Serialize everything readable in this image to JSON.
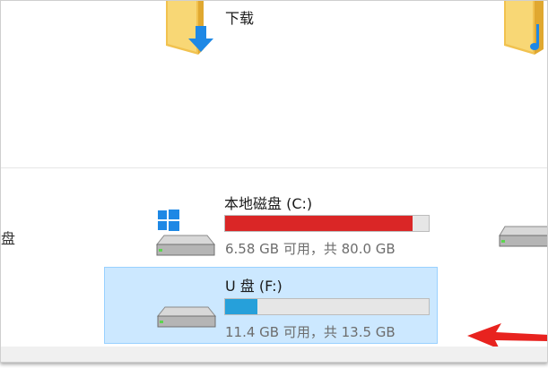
{
  "folders": [
    {
      "label": "下载",
      "icon": "downloads-folder-icon"
    },
    {
      "label": "",
      "icon": "music-folder-icon"
    }
  ],
  "left_partial_label": "盘",
  "drives": [
    {
      "name": "本地磁盘 (C:)",
      "info": "6.58 GB 可用，共 80.0 GB",
      "usage_fraction": 0.92,
      "bar_color": "#da2626",
      "icon": "windows-drive-icon"
    },
    {
      "name": "U 盘 (F:)",
      "info": "11.4 GB 可用，共 13.5 GB",
      "usage_fraction": 0.16,
      "bar_color": "#26a0da",
      "icon": "usb-drive-icon",
      "selected": true
    }
  ],
  "colors": {
    "selection_bg": "#cce8ff",
    "selection_border": "#99d1ff",
    "annotation_arrow": "#e8231f",
    "folder_yellow": "#f8d775",
    "download_arrow": "#1e88e5"
  }
}
